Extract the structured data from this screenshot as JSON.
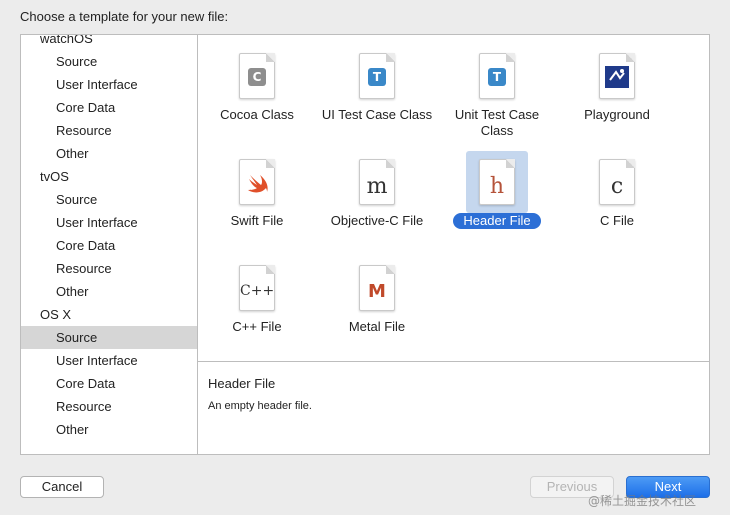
{
  "dialog": {
    "prompt": "Choose a template for your new file:"
  },
  "sidebar": {
    "rows": [
      {
        "label": "watchOS",
        "type": "platform"
      },
      {
        "label": "Source",
        "type": "item"
      },
      {
        "label": "User Interface",
        "type": "item"
      },
      {
        "label": "Core Data",
        "type": "item"
      },
      {
        "label": "Resource",
        "type": "item"
      },
      {
        "label": "Other",
        "type": "item"
      },
      {
        "label": "tvOS",
        "type": "platform"
      },
      {
        "label": "Source",
        "type": "item"
      },
      {
        "label": "User Interface",
        "type": "item"
      },
      {
        "label": "Core Data",
        "type": "item"
      },
      {
        "label": "Resource",
        "type": "item"
      },
      {
        "label": "Other",
        "type": "item"
      },
      {
        "label": "OS X",
        "type": "platform"
      },
      {
        "label": "Source",
        "type": "item",
        "selected": true
      },
      {
        "label": "User Interface",
        "type": "item"
      },
      {
        "label": "Core Data",
        "type": "item"
      },
      {
        "label": "Resource",
        "type": "item"
      },
      {
        "label": "Other",
        "type": "item"
      }
    ]
  },
  "templates": [
    {
      "label": "Cocoa Class",
      "icon": "cocoa-class-icon",
      "glyph": "C",
      "color": "#8e8e8e"
    },
    {
      "label": "UI Test Case Class",
      "icon": "ui-test-case-icon",
      "glyph": "T",
      "color": "#3a88c8"
    },
    {
      "label": "Unit Test Case Class",
      "icon": "unit-test-case-icon",
      "glyph": "T",
      "color": "#3a88c8"
    },
    {
      "label": "Playground",
      "icon": "playground-icon",
      "glyph": "",
      "color": "#1f3a8a"
    },
    {
      "label": "Swift File",
      "icon": "swift-file-icon",
      "glyph": "",
      "color": "#e0502a"
    },
    {
      "label": "Objective-C File",
      "icon": "objective-c-file-icon",
      "glyph": "m",
      "color": "#333333"
    },
    {
      "label": "Header File",
      "icon": "header-file-icon",
      "glyph": "h",
      "color": "#b5533a",
      "selected": true
    },
    {
      "label": "C File",
      "icon": "c-file-icon",
      "glyph": "c",
      "color": "#333333"
    },
    {
      "label": "C++ File",
      "icon": "cpp-file-icon",
      "glyph": "C++",
      "color": "#333333"
    },
    {
      "label": "Metal File",
      "icon": "metal-file-icon",
      "glyph": "M",
      "color": "#c0492a"
    }
  ],
  "description": {
    "title": "Header File",
    "text": "An empty header file."
  },
  "buttons": {
    "cancel": "Cancel",
    "previous": "Previous",
    "next": "Next"
  },
  "watermark": "@稀土掘金技术社区"
}
